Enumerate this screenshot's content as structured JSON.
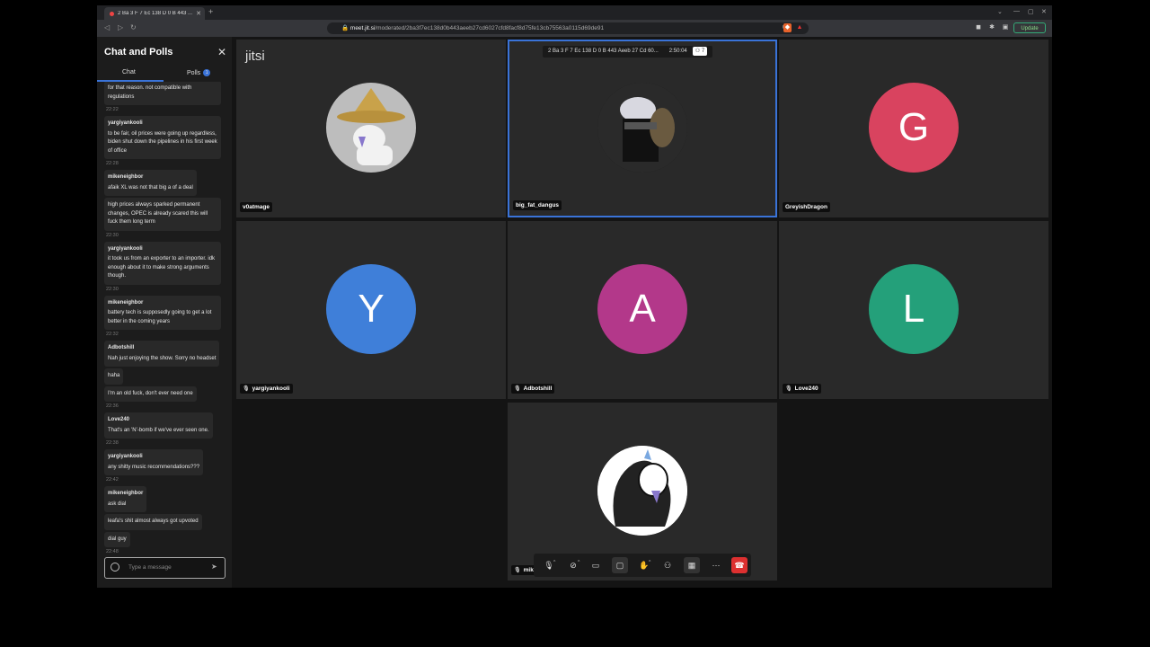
{
  "browser": {
    "tab_title": "2 Ba 3 F 7 Ec 138 D 0 B 443 ...",
    "url_host": "meet.jit.si",
    "url_path": "/moderated/2ba3f7ec138d0b443aeeb27cd6027cfd8facf8d75fe13cb75563a0115d69de91",
    "update_label": "Update"
  },
  "chat": {
    "title": "Chat and Polls",
    "tabs": {
      "chat": "Chat",
      "polls": "Polls",
      "polls_badge": "1"
    },
    "input_placeholder": "Type a message",
    "messages": [
      {
        "sender": "",
        "text": "for that reason. not compatible with regulations"
      },
      {
        "ts": "22:22"
      },
      {
        "sender": "yargiyankooli",
        "text": "to be fair, oil prices were going up regardless, biden shut down the pipelines in his first week of office"
      },
      {
        "ts": "22:28"
      },
      {
        "sender": "mikeneighbor",
        "text": "afaik XL was not that big a of a deal"
      },
      {
        "sender": "",
        "text": "high prices always sparked permanent changes, OPEC is already scared this will fuck them long term"
      },
      {
        "ts": "22:30"
      },
      {
        "sender": "yargiyankooli",
        "text": "it took us from an exporter to an importer. idk enough about it to make strong arguments though."
      },
      {
        "ts": "22:30"
      },
      {
        "sender": "mikeneighbor",
        "text": "battery tech is supposedly going to get a lot better in the coming years"
      },
      {
        "ts": "22:32"
      },
      {
        "sender": "Adbotshill",
        "text": "Nah just enjoying the show.  Sorry no headset"
      },
      {
        "sender": "",
        "text": "haha"
      },
      {
        "sender": "",
        "text": "I'm an old fuck, don't ever need one"
      },
      {
        "ts": "22:36"
      },
      {
        "sender": "Love240",
        "text": "That's an 'N'-bomb if we've ever seen one."
      },
      {
        "ts": "22:38"
      },
      {
        "sender": "yargiyankooli",
        "text": "any shitty music recommendations???"
      },
      {
        "ts": "22:42"
      },
      {
        "sender": "mikeneighbor",
        "text": "ask dial"
      },
      {
        "sender": "",
        "text": "leafa's shit almost always got upvoted"
      },
      {
        "sender": "",
        "text": "dial guy"
      },
      {
        "ts": "22:48"
      }
    ]
  },
  "meeting": {
    "logo": "jitsi",
    "room_name": "2 Ba 3 F 7 Ec 138 D 0 B 443 Aeeb 27 Cd 60...",
    "duration": "2:50:04",
    "participant_count": "7",
    "participants": [
      {
        "name": "v0atmage",
        "initial": "",
        "color": "#bdbdbd",
        "muted": false,
        "avatar_icon": "goat-wizard-avatar"
      },
      {
        "name": "big_fat_dangus",
        "initial": "",
        "color": "#1a1a1a",
        "muted": false,
        "avatar_icon": "assassin-avatar",
        "active": true
      },
      {
        "name": "GreyishDragon",
        "initial": "G",
        "color": "#d9435f",
        "muted": false
      },
      {
        "name": "yargiyankooli",
        "initial": "Y",
        "color": "#3f7fd9",
        "muted": true
      },
      {
        "name": "Adbotshill",
        "initial": "A",
        "color": "#b3388a",
        "muted": true
      },
      {
        "name": "Love240",
        "initial": "L",
        "color": "#24a07a",
        "muted": true
      },
      {
        "name": "mik",
        "initial": "",
        "color": "#ffffff",
        "muted": true,
        "avatar_icon": "goat-sketch-avatar"
      }
    ]
  },
  "toolbar": {
    "buttons": [
      "microphone-icon",
      "camera-off-icon",
      "screen-share-icon",
      "chat-icon",
      "raise-hand-icon",
      "participants-icon",
      "tile-view-icon",
      "more-icon",
      "hangup-icon"
    ]
  }
}
